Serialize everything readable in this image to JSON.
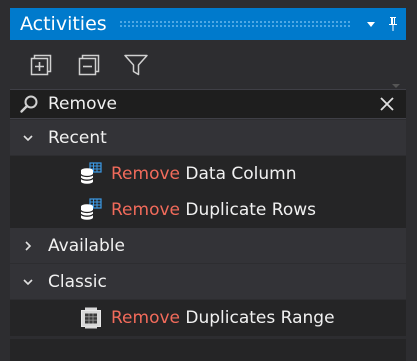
{
  "window": {
    "title": "Activities"
  },
  "colors": {
    "titlebar": "#007acc",
    "highlight": "#f26b5b",
    "panel": "#2d2d30",
    "list_bg": "#252526"
  },
  "toolbar": {
    "buttons": [
      {
        "name": "expand-all",
        "icon": "expand-all-icon"
      },
      {
        "name": "collapse-all",
        "icon": "collapse-all-icon"
      },
      {
        "name": "filter",
        "icon": "filter-icon"
      }
    ]
  },
  "search": {
    "value": "Remove",
    "icon": "search-icon",
    "clear_icon": "close-icon"
  },
  "tree": {
    "recent": {
      "label": "Recent",
      "expanded": true,
      "items": [
        {
          "highlight": "Remove",
          "rest": " Data Column",
          "icon": "data-table-icon"
        },
        {
          "highlight": "Remove",
          "rest": " Duplicate Rows",
          "icon": "data-table-icon"
        }
      ]
    },
    "available": {
      "label": "Available",
      "expanded": false
    },
    "classic": {
      "label": "Classic",
      "expanded": true,
      "items": [
        {
          "highlight": "Remove",
          "rest": " Duplicates Range",
          "icon": "excel-range-icon"
        }
      ]
    }
  }
}
